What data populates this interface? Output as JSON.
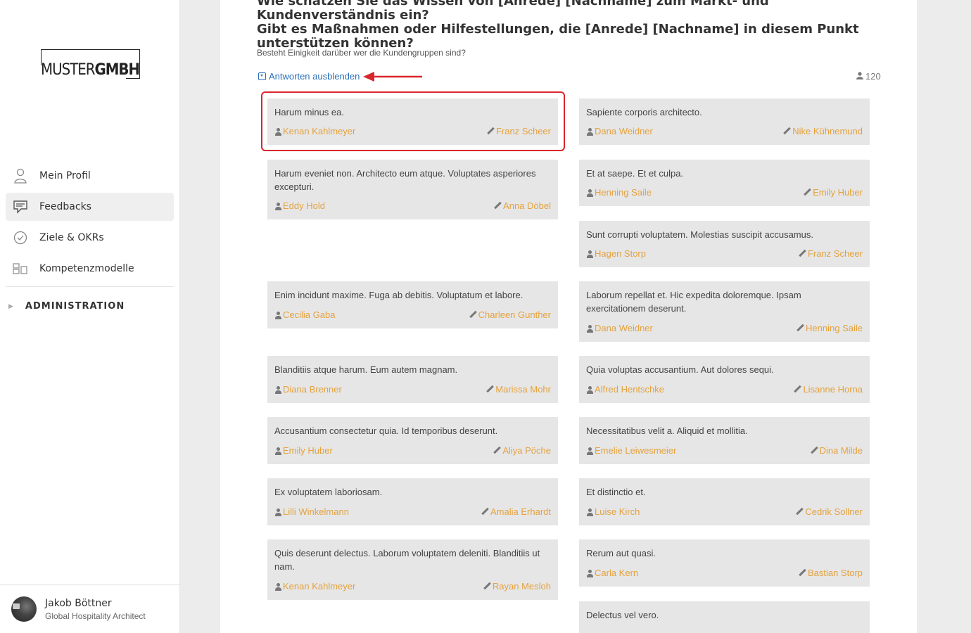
{
  "sidebar": {
    "logo": {
      "light": "MUSTER",
      "bold": "GMBH"
    },
    "nav": [
      {
        "label": "Mein Profil",
        "icon": "user-icon",
        "active": false
      },
      {
        "label": "Feedbacks",
        "icon": "chat-icon",
        "active": true
      },
      {
        "label": "Ziele & OKRs",
        "icon": "check-circle-icon",
        "active": false
      },
      {
        "label": "Kompetenzmodelle",
        "icon": "blocks-icon",
        "active": false
      }
    ],
    "admin_label": "ADMINISTRATION",
    "user": {
      "name": "Jakob Böttner",
      "role": "Global Hospitality Architect"
    }
  },
  "main": {
    "question_line1": "Wie schätzen Sie das Wissen von [Anrede] [Nachname] zum Markt- und Kundenverständnis ein?",
    "question_line2": "Gibt es Maßnahmen oder Hilfestellungen, die [Anrede] [Nachname] in diesem Punkt",
    "question_line3": "unterstützen können?",
    "subquestion": "Besteht Einigkeit darüber wer die Kundengruppen sind?",
    "toggle_label": "Antworten ausblenden",
    "count": "120",
    "accent_color": "#e4a23f",
    "highlight_color": "#d9262c"
  },
  "cards": [
    {
      "text": "Harum minus ea.",
      "person": "Kenan Kahlmeyer",
      "author": "Franz Scheer"
    },
    {
      "text": "Sapiente corporis architecto.",
      "person": "Dana Weidner",
      "author": "Nike Kühnemund"
    },
    {
      "text": "Harum eveniet non. Architecto eum atque. Voluptates asperiores excepturi.",
      "person": "Eddy Hold",
      "author": "Anna Döbel"
    },
    {
      "text": "Et at saepe. Et et culpa.",
      "person": "Henning Saile",
      "author": "Emily Huber"
    },
    {
      "text": "Sunt corrupti voluptatem. Molestias suscipit accusamus.",
      "person": "Hagen Storp",
      "author": "Franz Scheer"
    },
    {
      "text": "Enim incidunt maxime. Fuga ab debitis. Voluptatum et labore.",
      "person": "Cecilia Gaba",
      "author": "Charleen Gunther"
    },
    {
      "text": "Laborum repellat et. Hic expedita doloremque. Ipsam exercitationem deserunt.",
      "person": "Dana Weidner",
      "author": "Henning Saile"
    },
    {
      "text": "Blanditiis atque harum. Eum autem magnam.",
      "person": "Diana Brenner",
      "author": "Marissa Mohr"
    },
    {
      "text": "Quia voluptas accusantium. Aut dolores sequi.",
      "person": "Alfred Hentschke",
      "author": "Lisanne Horna"
    },
    {
      "text": "Accusantium consectetur quia. Id temporibus deserunt.",
      "person": "Emily Huber",
      "author": "Aliya Pöche"
    },
    {
      "text": "Necessitatibus velit a. Aliquid et mollitia.",
      "person": "Emelie Leiwesmeier",
      "author": "Dina Milde"
    },
    {
      "text": "Ex voluptatem laboriosam.",
      "person": "Lilli Winkelmann",
      "author": "Amalia Erhardt"
    },
    {
      "text": "Et distinctio et.",
      "person": "Luise Kirch",
      "author": "Cedrik Sollner"
    },
    {
      "text": "Quis deserunt delectus. Laborum voluptatem deleniti. Blanditiis ut nam.",
      "person": "Kenan Kahlmeyer",
      "author": "Rayan Mesloh"
    },
    {
      "text": "Rerum aut quasi.",
      "person": "Carla Kern",
      "author": "Bastian Storp"
    },
    {
      "text": "Delectus vel vero.",
      "person": "",
      "author": ""
    }
  ]
}
